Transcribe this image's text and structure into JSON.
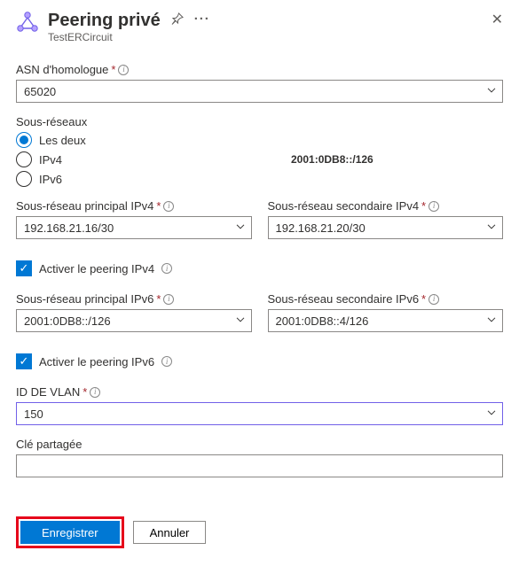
{
  "header": {
    "title": "Peering privé",
    "subtitle": "TestERCircuit"
  },
  "asn": {
    "label": "ASN d'homologue",
    "value": "65020"
  },
  "subnets": {
    "label": "Sous-réseaux",
    "options": {
      "both": "Les deux",
      "ipv4": "IPv4",
      "ipv6": "IPv6"
    },
    "annotation": "2001:0DB8::/126"
  },
  "primary_v4": {
    "label": "Sous-réseau principal IPv4",
    "value": "192.168.21.16/30"
  },
  "secondary_v4": {
    "label": "Sous-réseau secondaire IPv4",
    "value": "192.168.21.20/30"
  },
  "enable_v4": {
    "label": "Activer le peering IPv4"
  },
  "primary_v6": {
    "label": "Sous-réseau principal IPv6",
    "value": "2001:0DB8::/126"
  },
  "secondary_v6": {
    "label": "Sous-réseau secondaire IPv6",
    "value": "2001:0DB8::4/126"
  },
  "enable_v6": {
    "label": "Activer le peering IPv6"
  },
  "vlan": {
    "label": "ID DE VLAN",
    "value": "150"
  },
  "shared_key": {
    "label": "Clé partagée",
    "value": ""
  },
  "footer": {
    "save": "Enregistrer",
    "cancel": "Annuler"
  }
}
